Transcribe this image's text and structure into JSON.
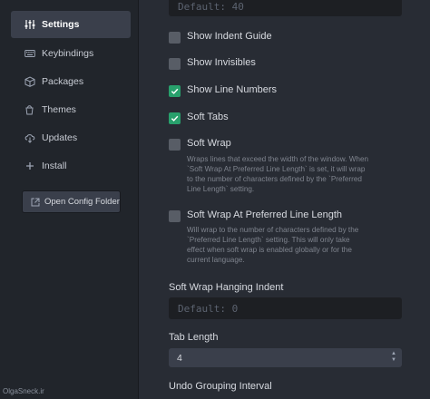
{
  "sidebar": {
    "items": [
      {
        "label": "Settings",
        "icon": "sliders-icon",
        "active": true
      },
      {
        "label": "Keybindings",
        "icon": "keyboard-icon",
        "active": false
      },
      {
        "label": "Packages",
        "icon": "package-icon",
        "active": false
      },
      {
        "label": "Themes",
        "icon": "paintcan-icon",
        "active": false
      },
      {
        "label": "Updates",
        "icon": "cloud-download-icon",
        "active": false
      },
      {
        "label": "Install",
        "icon": "plus-icon",
        "active": false
      }
    ],
    "open_config_label": "Open Config Folder"
  },
  "settings": {
    "top_field_value": "Default: 40",
    "show_indent_guide": {
      "label": "Show Indent Guide",
      "checked": false
    },
    "show_invisibles": {
      "label": "Show Invisibles",
      "checked": false
    },
    "show_line_numbers": {
      "label": "Show Line Numbers",
      "checked": true
    },
    "soft_tabs": {
      "label": "Soft Tabs",
      "checked": true
    },
    "soft_wrap": {
      "label": "Soft Wrap",
      "checked": false,
      "desc_lines": [
        "Wraps lines that exceed the width of the window. When",
        "`Soft Wrap At Preferred Line Length` is set, it will wrap",
        "to the number of characters defined by the `Preferred",
        "Line Length` setting."
      ]
    },
    "soft_wrap_preferred": {
      "label": "Soft Wrap At Preferred Line Length",
      "checked": false,
      "desc_lines": [
        "Will wrap to the number of characters defined by the",
        "`Preferred Line Length` setting. This will only take",
        "effect when soft wrap is enabled globally or for the",
        "current language."
      ]
    },
    "hanging_indent": {
      "title": "Soft Wrap Hanging Indent",
      "placeholder": "Default: 0"
    },
    "tab_length": {
      "title": "Tab Length",
      "value": "4"
    },
    "undo_grouping": {
      "title": "Undo Grouping Interval"
    }
  },
  "watermark": "OlgaSneck.ir",
  "colors": {
    "accent": "#28a06c",
    "sidebar_bg": "#21252b",
    "content_bg": "#282c34"
  }
}
